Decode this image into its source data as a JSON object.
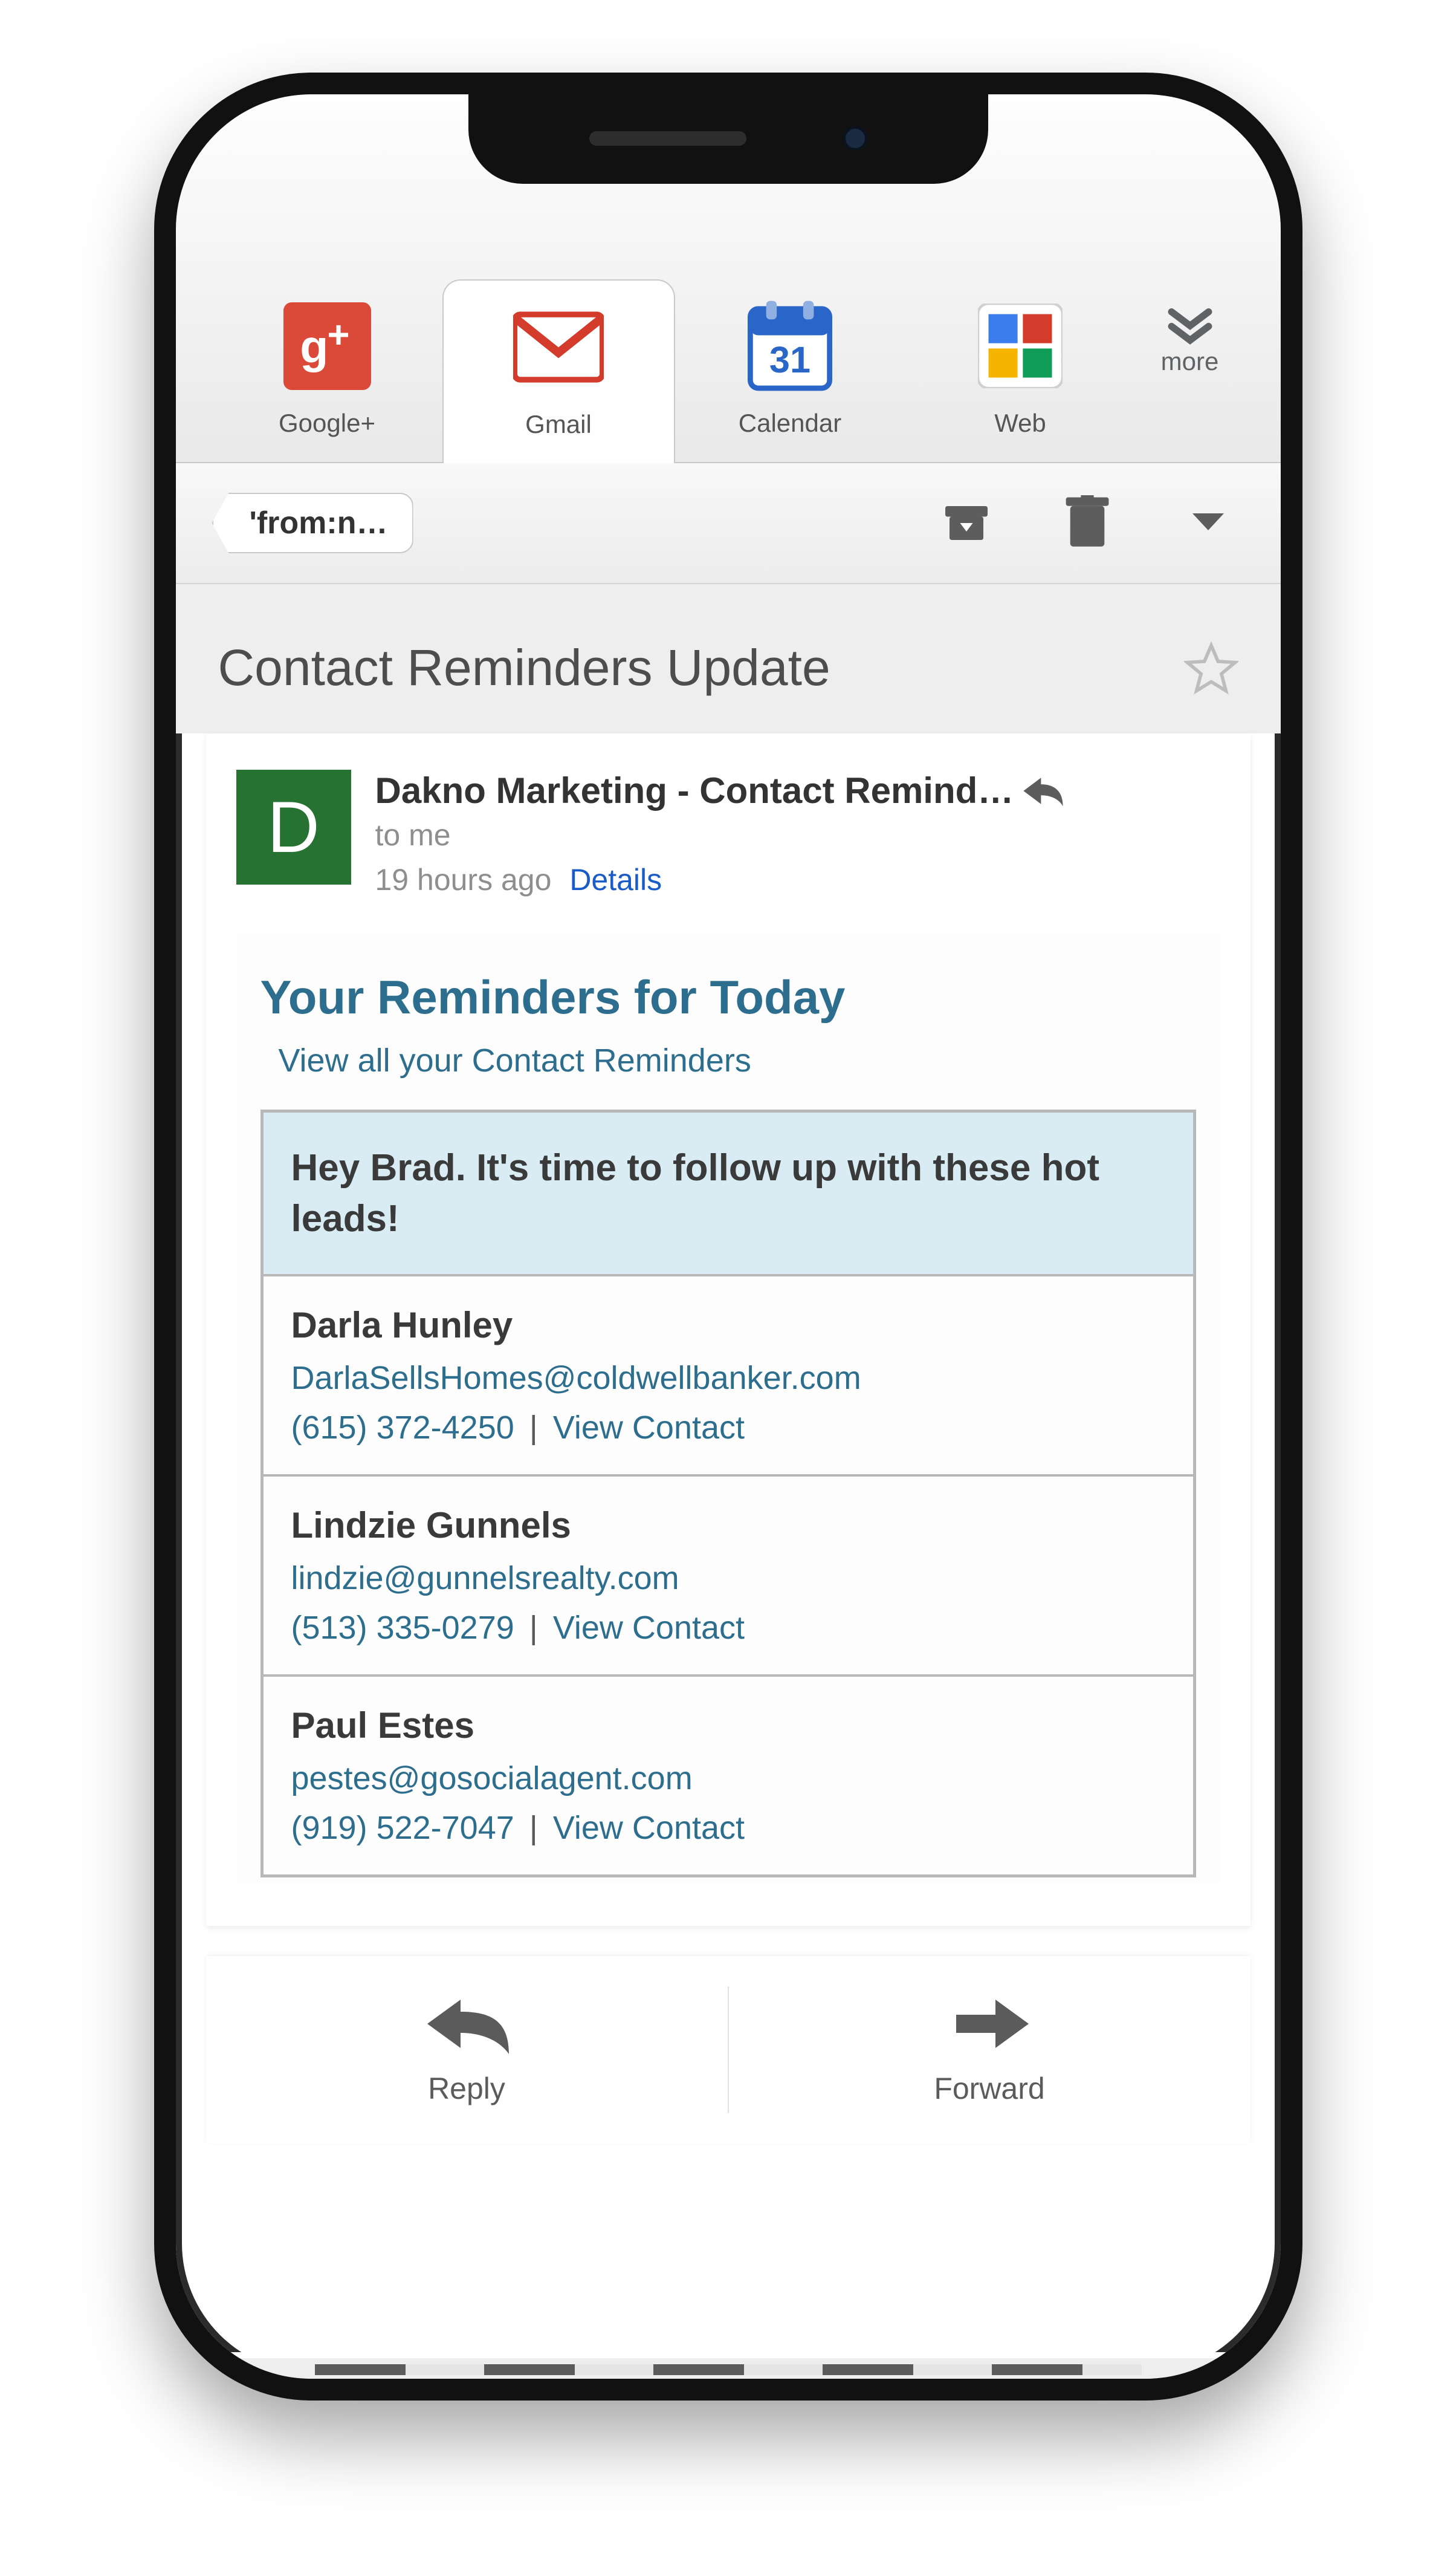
{
  "tabs": {
    "items": [
      {
        "label": "Google+"
      },
      {
        "label": "Gmail"
      },
      {
        "label": "Calendar",
        "day": "31"
      },
      {
        "label": "Web"
      }
    ],
    "more_label": "more"
  },
  "actionbar": {
    "filter_chip": "'from:n…"
  },
  "subject": "Contact Reminders Update",
  "message": {
    "avatar_initial": "D",
    "sender": "Dakno Marketing - Contact Remind…",
    "to_line": "to me",
    "time": "19 hours ago",
    "details_label": "Details"
  },
  "body": {
    "heading": "Your Reminders for Today",
    "view_all": "View all your Contact Reminders",
    "followup_text": "Hey Brad. It's time to follow up with these hot leads!",
    "view_contact_label": "View Contact",
    "leads": [
      {
        "name": "Darla Hunley",
        "email": "DarlaSellsHomes@coldwellbanker.com",
        "phone": "(615) 372-4250"
      },
      {
        "name": "Lindzie Gunnels",
        "email": "lindzie@gunnelsrealty.com",
        "phone": "(513) 335-0279"
      },
      {
        "name": "Paul Estes",
        "email": "pestes@gosocialagent.com",
        "phone": "(919) 522-7047"
      }
    ]
  },
  "footer": {
    "reply": "Reply",
    "forward": "Forward"
  }
}
